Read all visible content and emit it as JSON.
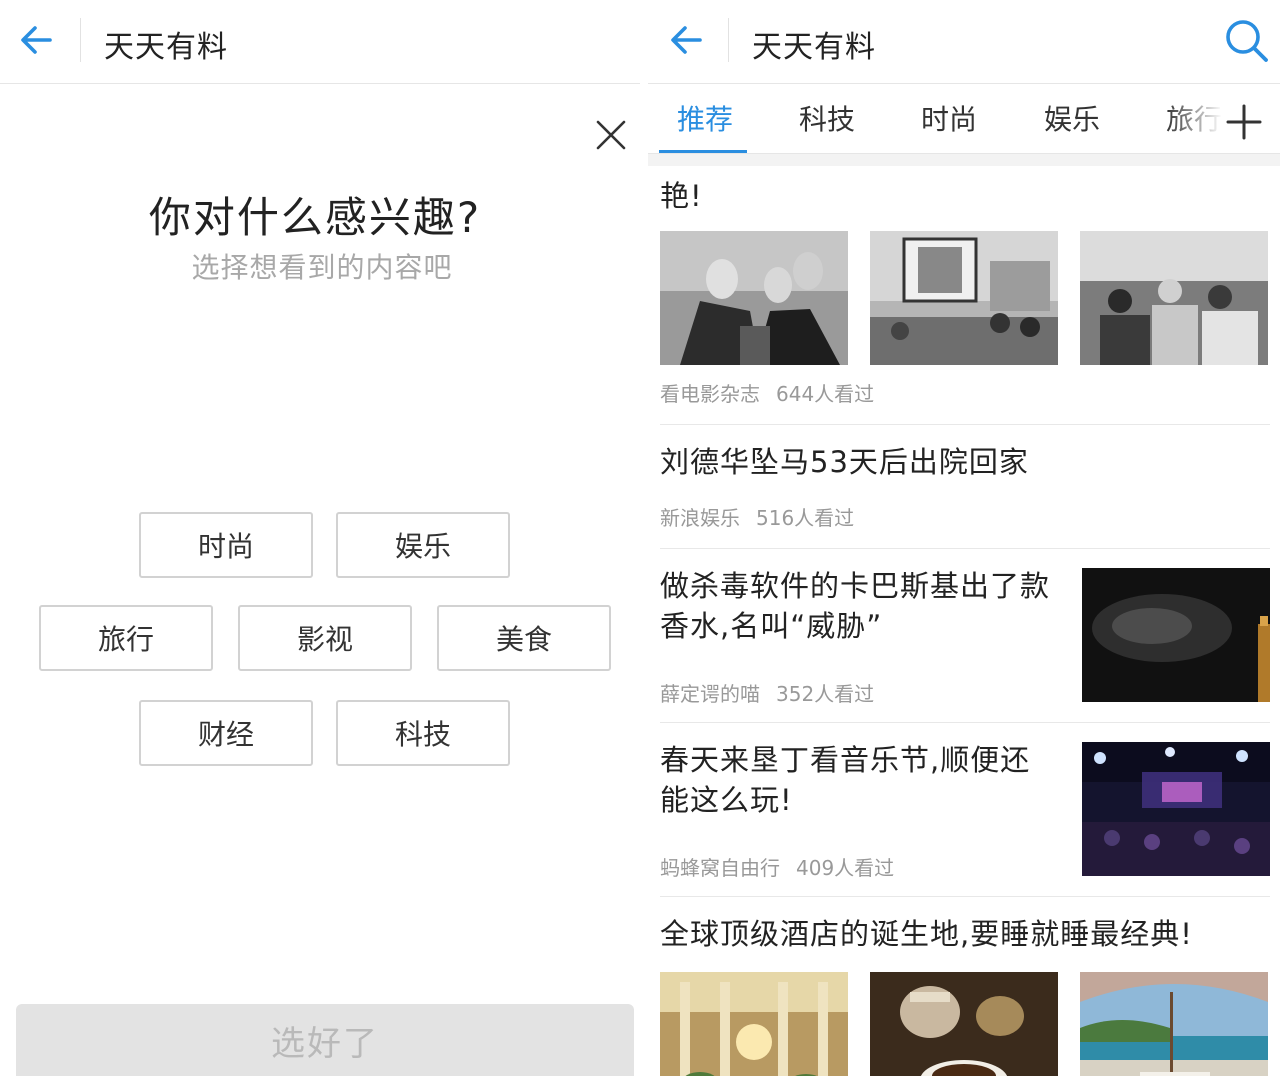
{
  "app": {
    "title": "天天有料"
  },
  "left": {
    "question": "你对什么感兴趣?",
    "subtitle": "选择想看到的内容吧",
    "tags": [
      "时尚",
      "娱乐",
      "旅行",
      "影视",
      "美食",
      "财经",
      "科技"
    ],
    "confirm_label": "选好了"
  },
  "right": {
    "tabs": [
      "推荐",
      "科技",
      "时尚",
      "娱乐",
      "旅行"
    ],
    "active_tab": 0,
    "articles": [
      {
        "title": "艳!",
        "source": "看电影杂志",
        "views": "644人看过",
        "layout": "three-images"
      },
      {
        "title": "刘德华坠马53天后出院回家",
        "source": "新浪娱乐",
        "views": "516人看过",
        "layout": "text-only"
      },
      {
        "title_lines": [
          "做杀毒软件的卡巴斯基出了款",
          "香水,名叫“威胁”"
        ],
        "source": "薛定谔的喵",
        "views": "352人看过",
        "layout": "right-image"
      },
      {
        "title_lines": [
          "春天来垦丁看音乐节,顺便还",
          "能这么玩!"
        ],
        "source": "蚂蜂窝自由行",
        "views": "409人看过",
        "layout": "right-image"
      },
      {
        "title": "全球顶级酒店的诞生地,要睡就睡最经典!",
        "layout": "three-images"
      }
    ]
  },
  "colors": {
    "accent": "#2a8ee0",
    "disabled_button": "#e3e3e3",
    "muted_text": "#999999"
  },
  "icons": [
    "back-arrow-icon",
    "close-icon",
    "search-icon",
    "plus-icon"
  ]
}
